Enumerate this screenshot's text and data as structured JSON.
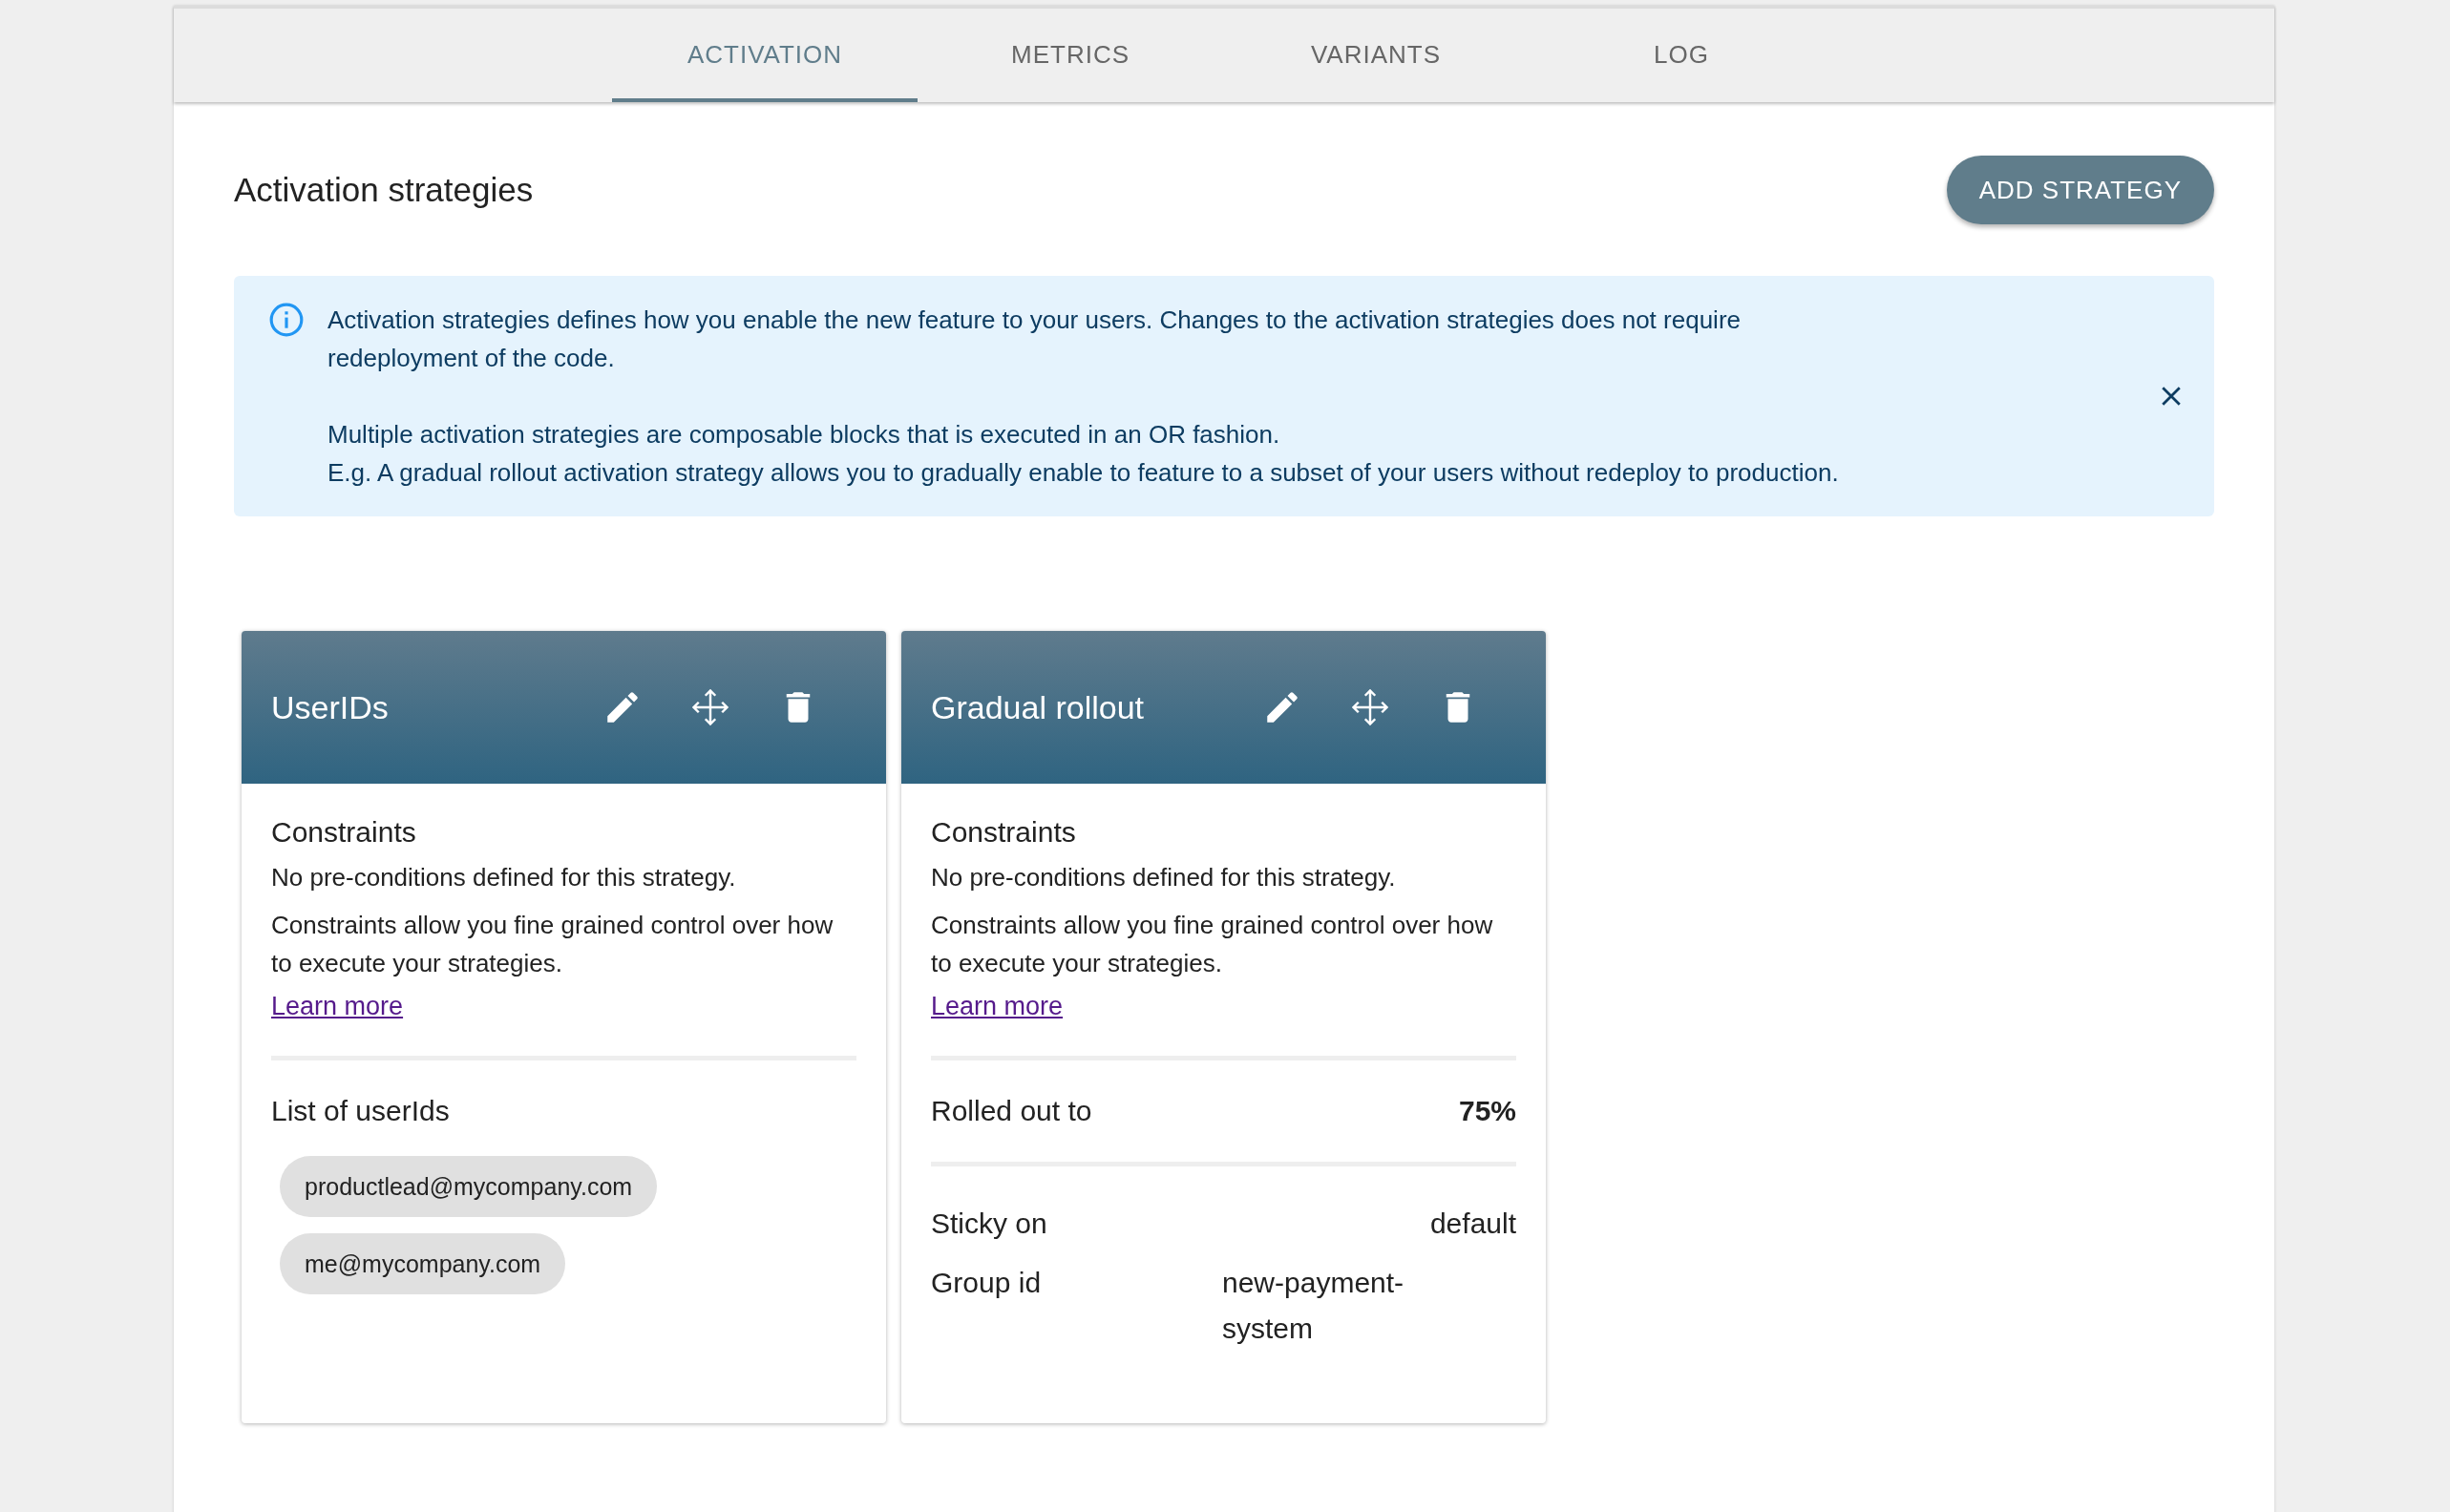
{
  "tabs": [
    {
      "label": "ACTIVATION",
      "selected": true
    },
    {
      "label": "METRICS",
      "selected": false
    },
    {
      "label": "VARIANTS",
      "selected": false
    },
    {
      "label": "LOG",
      "selected": false
    }
  ],
  "heading": "Activation strategies",
  "add_button": "ADD STRATEGY",
  "info": {
    "paragraphs": [
      [
        "Activation strategies defines how you enable the new feature to your users. Changes to the activation strategies does not require redeployment of the code."
      ],
      [
        "Multiple activation strategies are composable blocks that is executed in an OR fashion.",
        "E.g. A gradual rollout activation strategy allows you to gradually enable to feature to a subset of your users without redeploy to production."
      ]
    ]
  },
  "strategies": [
    {
      "title": "UserIDs",
      "kind": "userids",
      "constraints": {
        "title": "Constraints",
        "empty": "No pre-conditions defined for this strategy.",
        "hint": "Constraints allow you fine grained control over how to execute your strategies.",
        "link": "Learn more"
      },
      "list_label": "List of userIds",
      "chips": [
        "productlead@mycompany.com",
        "me@mycompany.com"
      ]
    },
    {
      "title": "Gradual rollout",
      "kind": "rollout",
      "constraints": {
        "title": "Constraints",
        "empty": "No pre-conditions defined for this strategy.",
        "hint": "Constraints allow you fine grained control over how to execute your strategies.",
        "link": "Learn more"
      },
      "rollout": {
        "label": "Rolled out to",
        "value": "75%"
      },
      "fields": [
        {
          "kind": "choice",
          "label": "Sticky on",
          "value": "default"
        },
        {
          "kind": "text",
          "label": "Group id",
          "value": "new-payment-system"
        }
      ]
    }
  ]
}
